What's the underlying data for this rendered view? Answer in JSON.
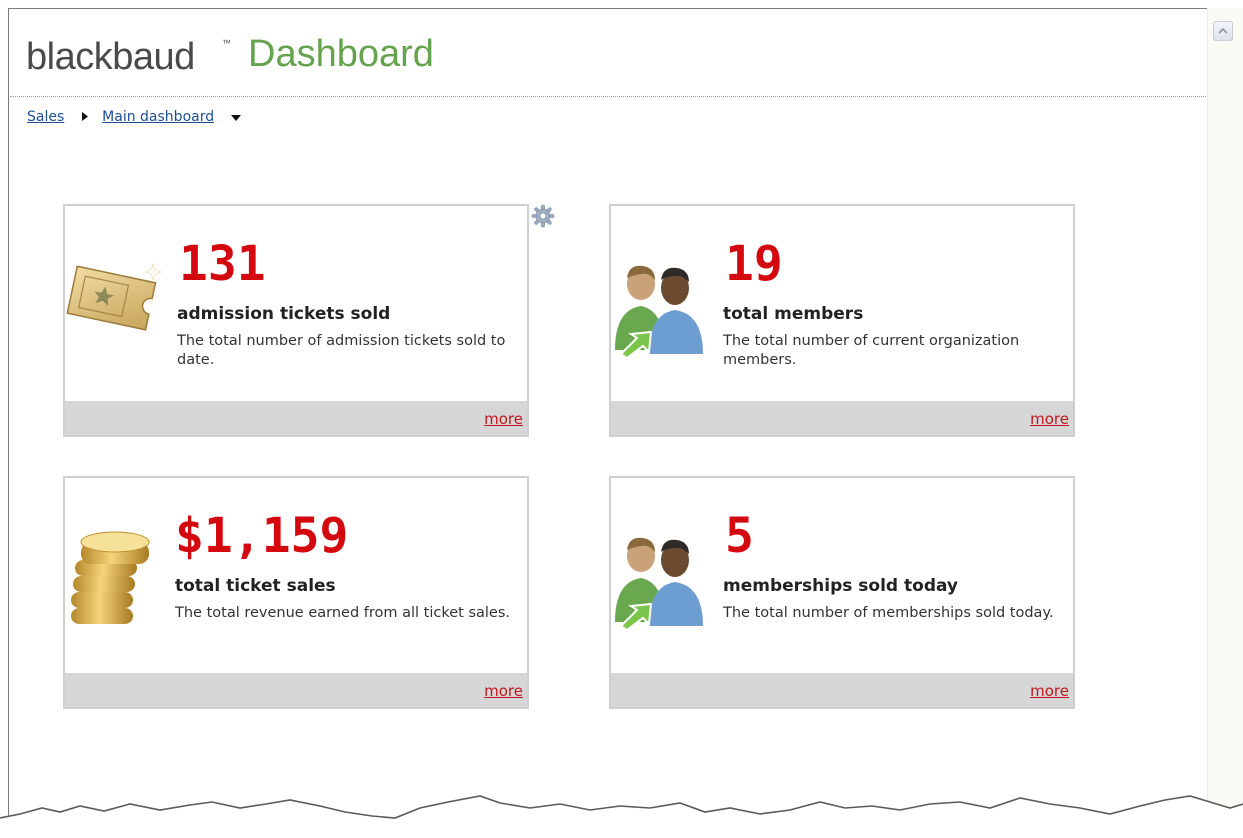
{
  "header": {
    "brand": "blackbaud",
    "trademark": "™",
    "product": "Dashboard",
    "accent_color": "#66a34f"
  },
  "breadcrumb": {
    "items": [
      {
        "label": "Sales"
      },
      {
        "label": "Main dashboard"
      }
    ],
    "separator_icon": "triangle-right-icon",
    "dropdown_icon": "triangle-down-icon"
  },
  "settings_icon": "gear-icon",
  "cards": [
    {
      "value": "131",
      "title": "admission tickets sold",
      "description": "The total number of admission tickets sold to date.",
      "more_label": "more",
      "icon": "ticket-icon"
    },
    {
      "value": "19",
      "title": "total members",
      "description": "The total number of current organization members.",
      "more_label": "more",
      "icon": "members-icon"
    },
    {
      "value": "$1,159",
      "title": "total ticket sales",
      "description": "The total revenue earned from all ticket sales.",
      "more_label": "more",
      "icon": "coins-icon"
    },
    {
      "value": "5",
      "title": "memberships sold today",
      "description": "The total number of memberships sold today.",
      "more_label": "more",
      "icon": "members-icon"
    }
  ],
  "colors": {
    "value_red": "#d4080f",
    "link_blue": "#1d4f91",
    "footer_gray": "#d6d6d6"
  }
}
